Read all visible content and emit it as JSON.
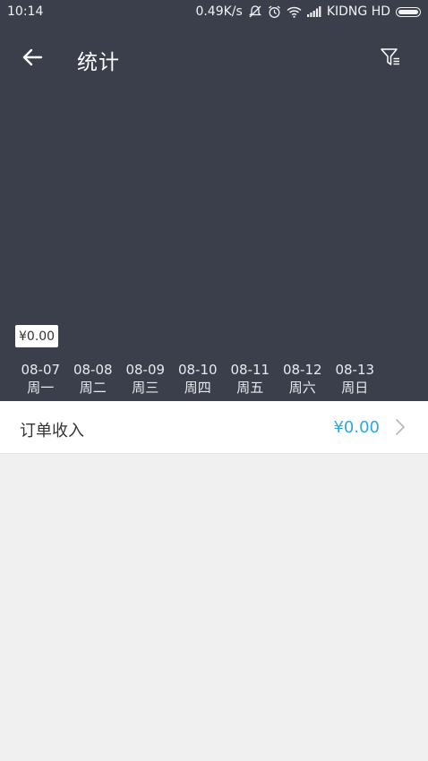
{
  "status_bar": {
    "time": "10:14",
    "network_speed": "0.49K/s",
    "carrier": "KIDNG HD",
    "icons": [
      "mute-icon",
      "alarm-icon",
      "wifi-icon",
      "signal-icon",
      "battery-icon"
    ]
  },
  "app_bar": {
    "title": "统计",
    "back_icon": "arrow-left-icon",
    "filter_icon": "filter-icon"
  },
  "chart": {
    "selected_value": "¥0.00",
    "days": [
      {
        "date": "08-07",
        "weekday": "周一"
      },
      {
        "date": "08-08",
        "weekday": "周二"
      },
      {
        "date": "08-09",
        "weekday": "周三"
      },
      {
        "date": "08-10",
        "weekday": "周四"
      },
      {
        "date": "08-11",
        "weekday": "周五"
      },
      {
        "date": "08-12",
        "weekday": "周六"
      },
      {
        "date": "08-13",
        "weekday": "周日"
      }
    ]
  },
  "income_row": {
    "label": "订单收入",
    "amount": "¥0.00"
  },
  "colors": {
    "header_bg": "#3b3f4c",
    "accent": "#2ea7e0",
    "page_bg": "#f0f0f0"
  }
}
